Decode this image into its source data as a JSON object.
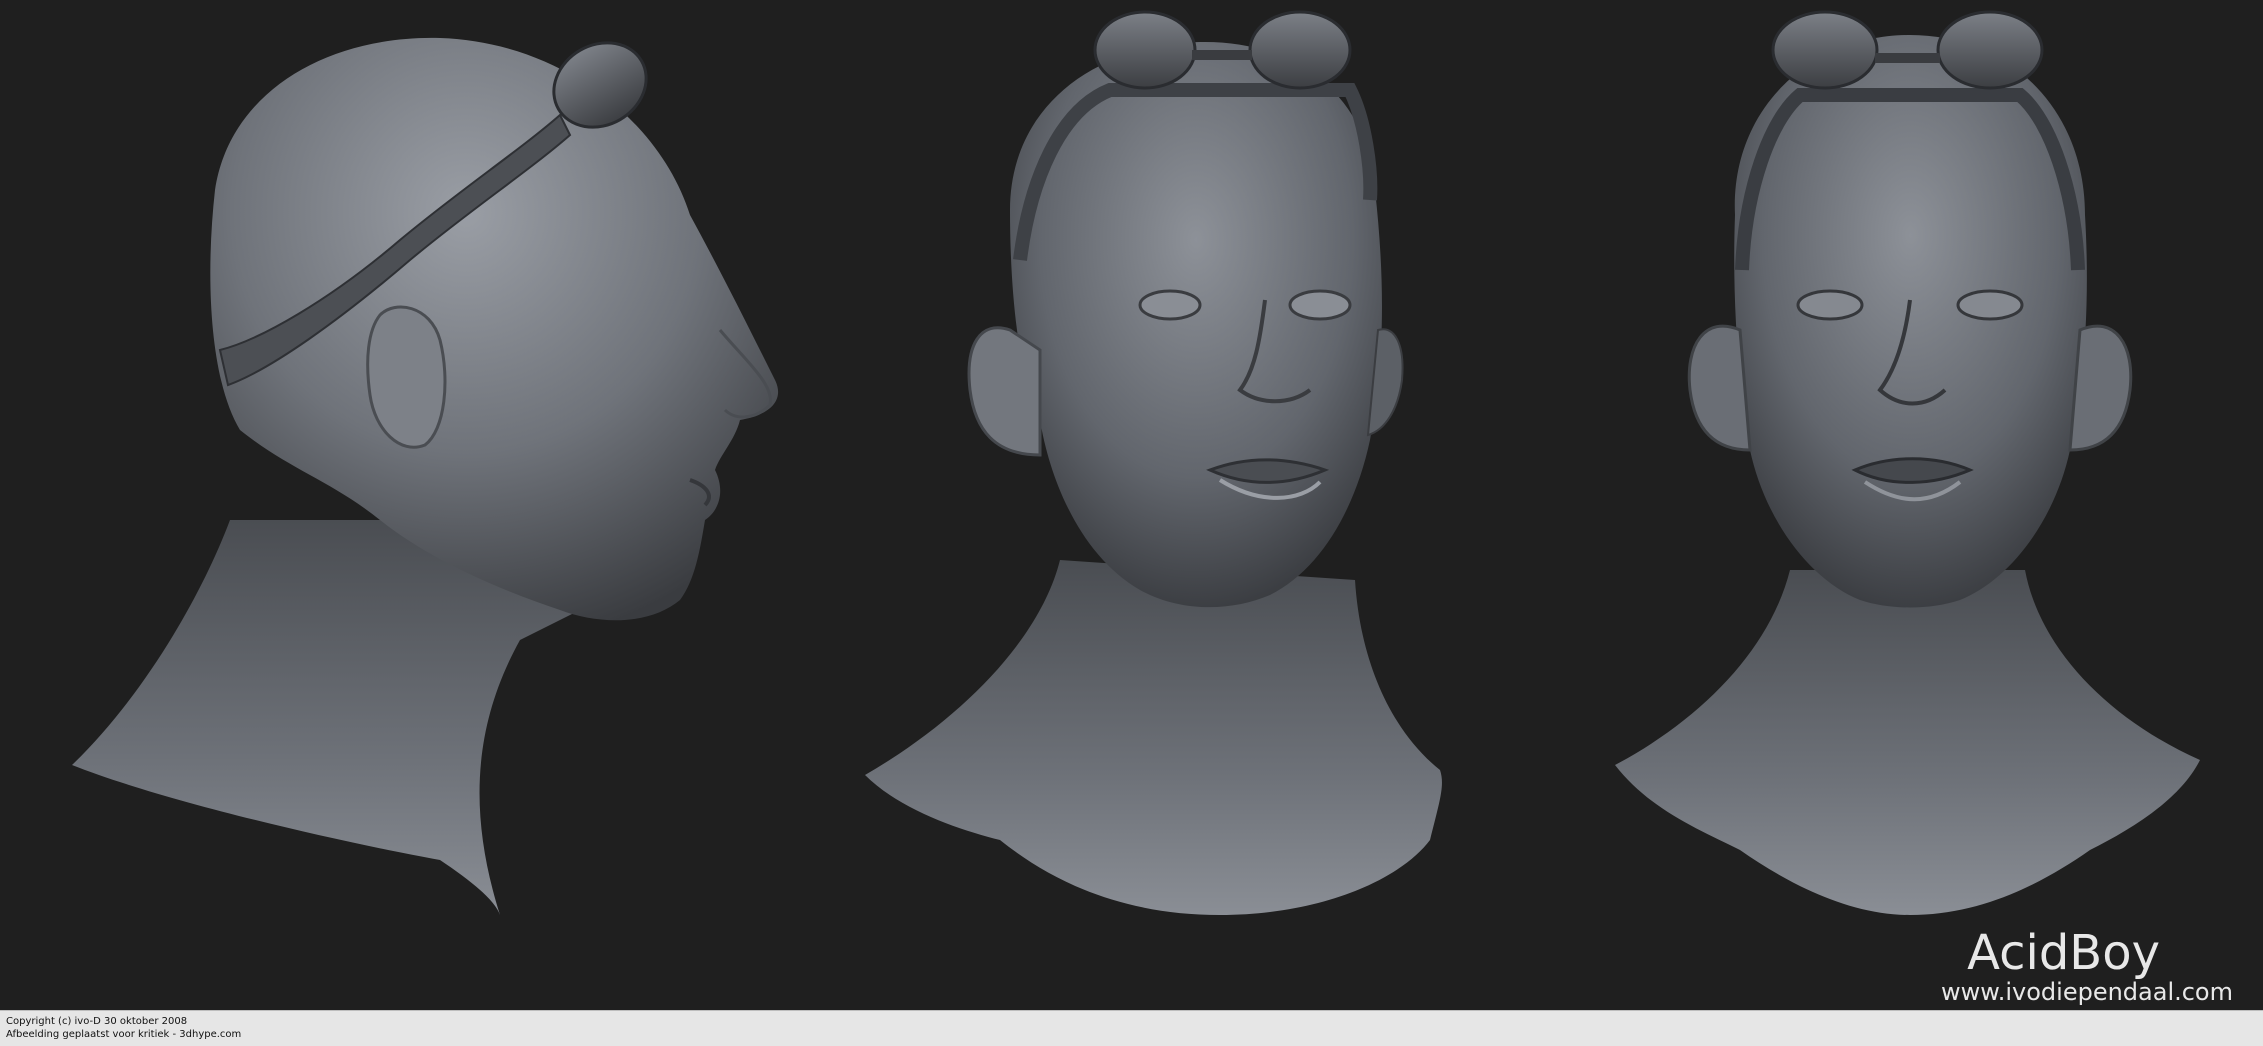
{
  "image": {
    "subject": "three-view digital sculpt of a bald male head with goggles",
    "views": [
      "side-view",
      "three-quarter-view",
      "front-view"
    ],
    "colors": {
      "background": "#1f1f1f",
      "clay": "#6f737a",
      "clay_highlight": "#9a9ea5",
      "clay_shadow": "#3a3c40",
      "footer_bg": "#e6e6e6"
    }
  },
  "watermark": {
    "title": "AcidBoy",
    "url": "www.ivodiependaal.com"
  },
  "footer": {
    "line1": "Copyright (c) ivo-D 30 oktober 2008",
    "line2": "Afbeelding geplaatst voor kritiek - 3dhype.com"
  }
}
